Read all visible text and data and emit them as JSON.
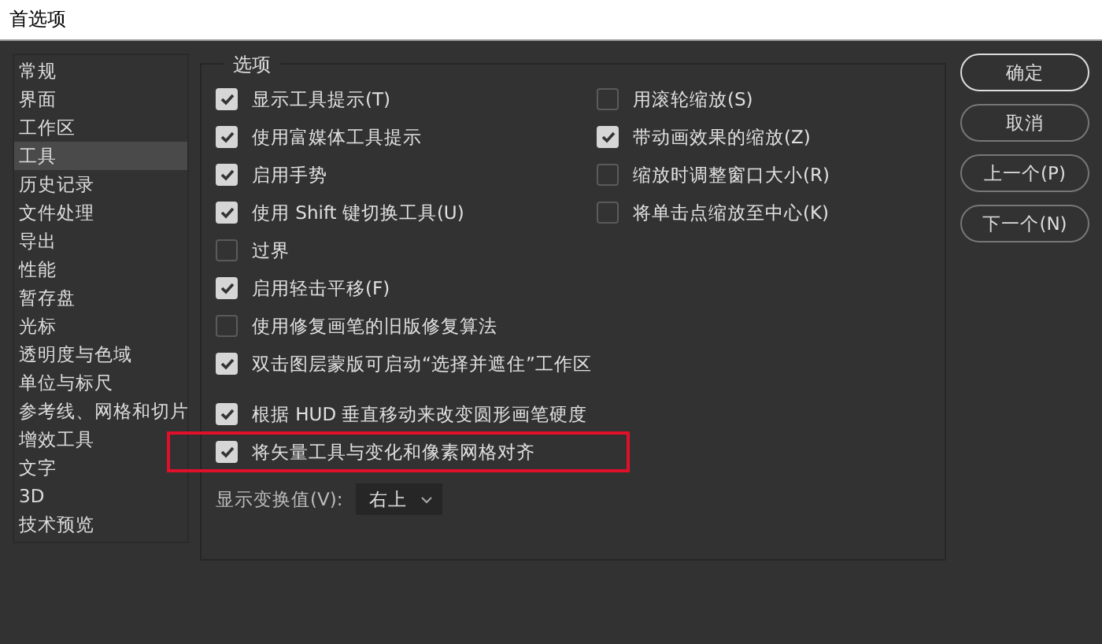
{
  "window": {
    "title": "首选项"
  },
  "sidebar": {
    "items": [
      {
        "label": "常规",
        "selected": false
      },
      {
        "label": "界面",
        "selected": false
      },
      {
        "label": "工作区",
        "selected": false
      },
      {
        "label": "工具",
        "selected": true
      },
      {
        "label": "历史记录",
        "selected": false
      },
      {
        "label": "文件处理",
        "selected": false
      },
      {
        "label": "导出",
        "selected": false
      },
      {
        "label": "性能",
        "selected": false
      },
      {
        "label": "暂存盘",
        "selected": false
      },
      {
        "label": "光标",
        "selected": false
      },
      {
        "label": "透明度与色域",
        "selected": false
      },
      {
        "label": "单位与标尺",
        "selected": false
      },
      {
        "label": "参考线、网格和切片",
        "selected": false
      },
      {
        "label": "增效工具",
        "selected": false
      },
      {
        "label": "文字",
        "selected": false
      },
      {
        "label": "3D",
        "selected": false
      },
      {
        "label": "技术预览",
        "selected": false
      }
    ]
  },
  "options": {
    "title": "选项",
    "left": [
      {
        "label": "显示工具提示(T)",
        "checked": true,
        "highlighted": false
      },
      {
        "label": "使用富媒体工具提示",
        "checked": true,
        "highlighted": false
      },
      {
        "label": "启用手势",
        "checked": true,
        "highlighted": false
      },
      {
        "label": "使用 Shift 键切换工具(U)",
        "checked": true,
        "highlighted": false
      },
      {
        "label": "过界",
        "checked": false,
        "highlighted": false
      },
      {
        "label": "启用轻击平移(F)",
        "checked": true,
        "highlighted": false
      },
      {
        "label": "使用修复画笔的旧版修复算法",
        "checked": false,
        "highlighted": false
      },
      {
        "label": "双击图层蒙版可启动“选择并遮住”工作区",
        "checked": true,
        "highlighted": false
      },
      {
        "label": "根据 HUD 垂直移动来改变圆形画笔硬度",
        "checked": true,
        "highlighted": false
      },
      {
        "label": "将矢量工具与变化和像素网格对齐",
        "checked": true,
        "highlighted": true
      }
    ],
    "right": [
      {
        "label": "用滚轮缩放(S)",
        "checked": false
      },
      {
        "label": "带动画效果的缩放(Z)",
        "checked": true
      },
      {
        "label": "缩放时调整窗口大小(R)",
        "checked": false
      },
      {
        "label": "将单击点缩放至中心(K)",
        "checked": false
      }
    ],
    "transform": {
      "label": "显示变换值(V):",
      "value": "右上"
    }
  },
  "buttons": [
    {
      "label": "确定",
      "primary": true
    },
    {
      "label": "取消",
      "primary": false
    },
    {
      "label": "上一个(P)",
      "primary": false
    },
    {
      "label": "下一个(N)",
      "primary": false
    }
  ]
}
